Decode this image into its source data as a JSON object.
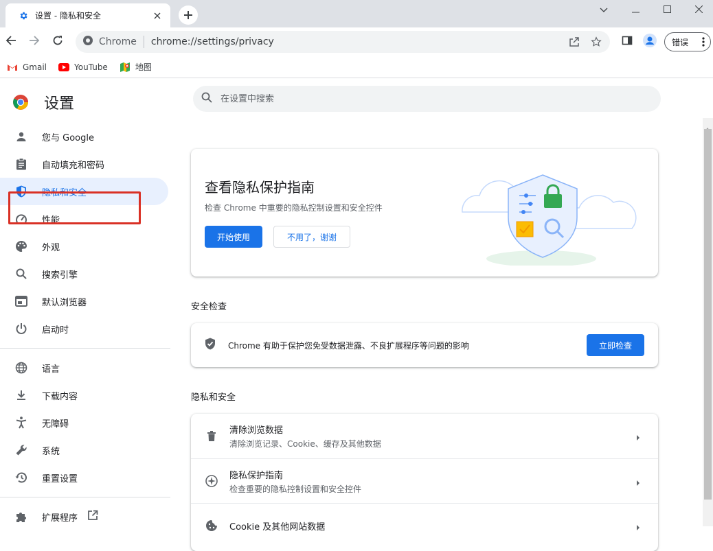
{
  "tab": {
    "title": "设置 - 隐私和安全",
    "icon": "gear-icon"
  },
  "toolbar": {
    "site_name": "Chrome",
    "url": "chrome://settings/privacy",
    "profile_error_label": "错误"
  },
  "bookmarks": [
    {
      "label": "Gmail",
      "icon": "gmail-icon"
    },
    {
      "label": "YouTube",
      "icon": "youtube-icon"
    },
    {
      "label": "地图",
      "icon": "maps-icon"
    }
  ],
  "header": {
    "title": "设置",
    "search_placeholder": "在设置中搜索"
  },
  "sidebar": {
    "items": [
      {
        "label": "您与 Google",
        "icon": "person-icon"
      },
      {
        "label": "自动填充和密码",
        "icon": "clipboard-icon"
      },
      {
        "label": "隐私和安全",
        "icon": "shield-icon",
        "active": true
      },
      {
        "label": "性能",
        "icon": "speedometer-icon"
      },
      {
        "label": "外观",
        "icon": "palette-icon"
      },
      {
        "label": "搜索引擎",
        "icon": "search-icon"
      },
      {
        "label": "默认浏览器",
        "icon": "browser-icon"
      },
      {
        "label": "启动时",
        "icon": "power-icon"
      }
    ],
    "items2": [
      {
        "label": "语言",
        "icon": "globe-icon"
      },
      {
        "label": "下载内容",
        "icon": "download-icon"
      },
      {
        "label": "无障碍",
        "icon": "accessibility-icon"
      },
      {
        "label": "系统",
        "icon": "wrench-icon"
      },
      {
        "label": "重置设置",
        "icon": "history-icon"
      }
    ],
    "extensions_label": "扩展程序"
  },
  "guide": {
    "title": "查看隐私保护指南",
    "subtitle": "检查 Chrome 中重要的隐私控制设置和安全控件",
    "start_label": "开始使用",
    "dismiss_label": "不用了，谢谢"
  },
  "safety_check": {
    "section_title": "安全检查",
    "text": "Chrome 有助于保护您免受数据泄露、不良扩展程序等问题的影响",
    "button_label": "立即检查"
  },
  "privacy": {
    "section_title": "隐私和安全",
    "rows": [
      {
        "title": "清除浏览数据",
        "subtitle": "清除浏览记录、Cookie、缓存及其他数据",
        "icon": "trash-icon"
      },
      {
        "title": "隐私保护指南",
        "subtitle": "检查重要的隐私控制设置和安全控件",
        "icon": "compass-icon"
      },
      {
        "title": "Cookie 及其他网站数据",
        "subtitle": "",
        "icon": "cookie-icon"
      }
    ]
  },
  "colors": {
    "accent": "#1a73e8",
    "highlight": "#d93025",
    "active_bg": "#e8f0fe"
  }
}
